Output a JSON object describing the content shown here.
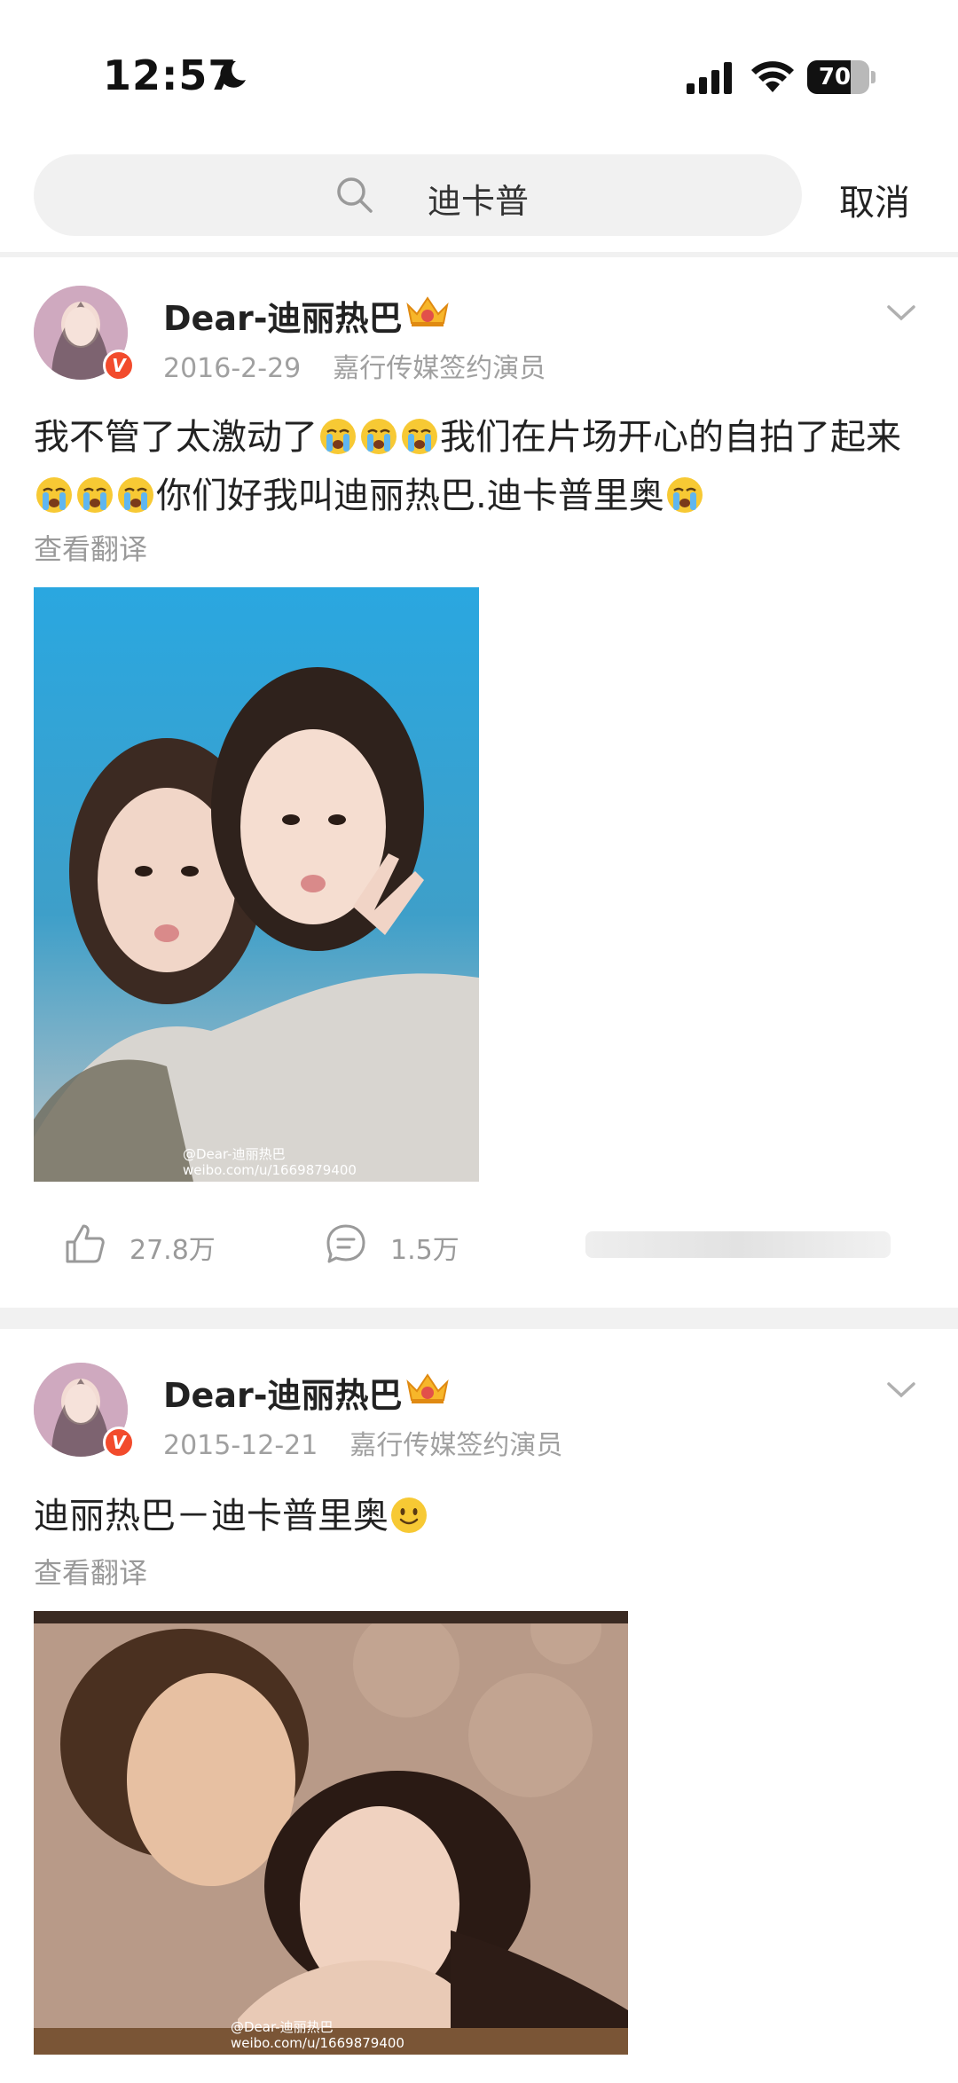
{
  "status_bar": {
    "time": "12:57",
    "battery": "70",
    "battery_level": 0.7
  },
  "search": {
    "query": "迪卡普",
    "cancel": "取消"
  },
  "posts": [
    {
      "username": "Dear-迪丽热巴",
      "date": "2016-2-29",
      "source": "嘉行传媒签约演员",
      "segments": [
        "我不管了太激动了",
        "我们在片场开心的自拍了起来",
        "你们好我叫迪丽热巴.迪卡普里奥"
      ],
      "emoji": "crying-face",
      "translate": "查看翻译",
      "watermark_line1": "@Dear-迪丽热巴",
      "watermark_line2": "weibo.com/u/1669879400",
      "likes": "27.8万",
      "comments": "1.5万"
    },
    {
      "username": "Dear-迪丽热巴",
      "date": "2015-12-21",
      "source": "嘉行传媒签约演员",
      "text": "迪丽热巴－迪卡普里奥",
      "emoji": "smiling-face",
      "translate": "查看翻译",
      "watermark_line1": "@Dear-迪丽热巴",
      "watermark_line2": "weibo.com/u/1669879400"
    }
  ],
  "colors": {
    "verified_badge": "#f24b2c",
    "secondary_text": "#a0a0a0",
    "divider": "#f1f1f1"
  }
}
